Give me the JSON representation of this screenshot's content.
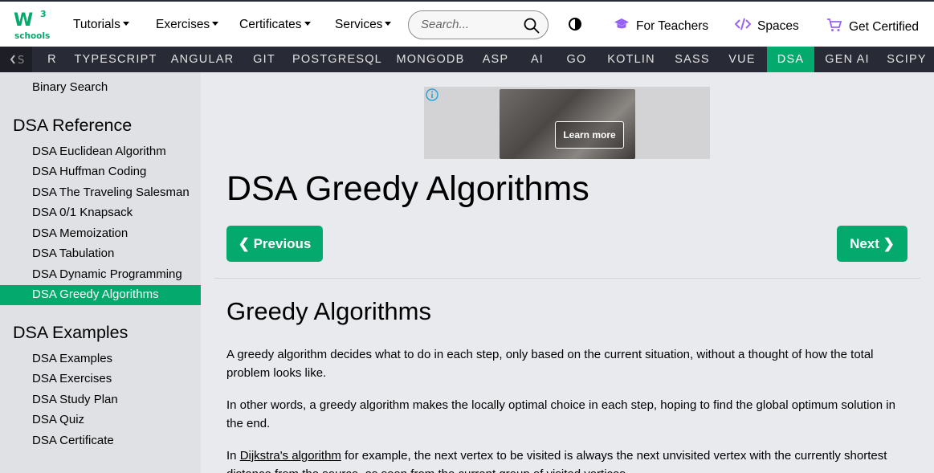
{
  "topnav": {
    "logo_text": "schools",
    "logo_sup": "3",
    "tutorials": "Tutorials",
    "exercises": "Exercises",
    "certificates": "Certificates",
    "services": "Services",
    "search_placeholder": "Search...",
    "for_teachers": "For Teachers",
    "spaces": "Spaces",
    "get_certified": "Get Certified",
    "colors": {
      "brand": "#04aa6d",
      "accent": "#9763f6"
    }
  },
  "subnav": {
    "items": [
      "R",
      "TYPESCRIPT",
      "ANGULAR",
      "GIT",
      "POSTGRESQL",
      "MONGODB",
      "ASP",
      "AI",
      "GO",
      "KOTLIN",
      "SASS",
      "VUE",
      "DSA",
      "GEN AI",
      "SCIPY"
    ],
    "active": "DSA"
  },
  "sidebar": {
    "top_link": "Binary Search",
    "reference_heading": "DSA Reference",
    "reference_items": [
      "DSA Euclidean Algorithm",
      "DSA Huffman Coding",
      "DSA The Traveling Salesman",
      "DSA 0/1 Knapsack",
      "DSA Memoization",
      "DSA Tabulation",
      "DSA Dynamic Programming",
      "DSA Greedy Algorithms"
    ],
    "active_item": "DSA Greedy Algorithms",
    "examples_heading": "DSA Examples",
    "examples_items": [
      "DSA Examples",
      "DSA Exercises",
      "DSA Study Plan",
      "DSA Quiz",
      "DSA Certificate"
    ]
  },
  "ad": {
    "button_label": "Learn more",
    "info_icon": "info-icon"
  },
  "main": {
    "title": "DSA Greedy Algorithms",
    "prev_label": "❮ Previous",
    "next_label": "Next ❯",
    "section_title": "Greedy Algorithms",
    "p1": "A greedy algorithm decides what to do in each step, only based on the current situation, without a thought of how the total problem looks like.",
    "p2": "In other words, a greedy algorithm makes the locally optimal choice in each step, hoping to find the global optimum solution in the end.",
    "p3_prefix": "In ",
    "p3_link": "Dijkstra's algorithm",
    "p3_suffix": " for example, the next vertex to be visited is always the next unvisited vertex with the currently shortest distance from the source, as seen from the current group of visited vertices."
  }
}
